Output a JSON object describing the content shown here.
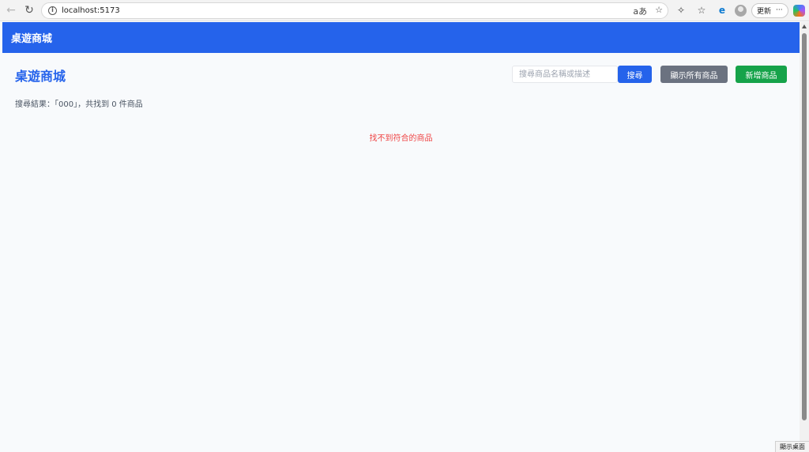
{
  "browser": {
    "url": "localhost:5173",
    "read_aloud_label": "aあ",
    "update_label": "更新",
    "more_label": "···"
  },
  "app": {
    "header_title": "桌遊商城",
    "page_title": "桌遊商城",
    "search": {
      "placeholder": "搜尋商品名稱或描述",
      "value": ""
    },
    "buttons": {
      "search": "搜尋",
      "show_all": "顯示所有商品",
      "add_new": "新增商品"
    },
    "result_text": "搜尋結果：「000」，共找到 0 件商品",
    "empty_message": "找不到符合的商品"
  },
  "taskbar": {
    "desktop_peek": "顯示桌面"
  },
  "colors": {
    "primary": "#2563eb",
    "secondary": "#6b7280",
    "success": "#16a34a",
    "danger": "#ef4444",
    "background": "#f8fafc"
  }
}
